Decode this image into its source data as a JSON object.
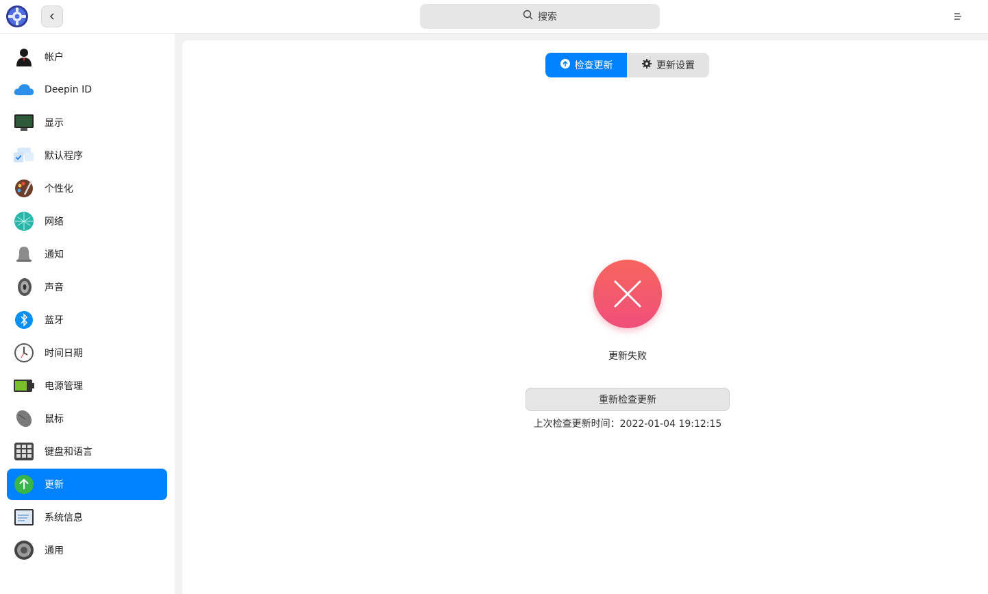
{
  "titlebar": {
    "search_placeholder": "搜索",
    "icons": {
      "logo": "settings-gear-logo-icon",
      "back": "chevron-left-icon",
      "menu": "menu-icon",
      "search": "search-icon"
    }
  },
  "sidebar": {
    "items": [
      {
        "label": "帐户",
        "icon": "account-icon"
      },
      {
        "label": "Deepin ID",
        "icon": "cloud-icon"
      },
      {
        "label": "显示",
        "icon": "monitor-icon"
      },
      {
        "label": "默认程序",
        "icon": "default-apps-icon"
      },
      {
        "label": "个性化",
        "icon": "palette-icon"
      },
      {
        "label": "网络",
        "icon": "network-icon"
      },
      {
        "label": "通知",
        "icon": "bell-icon"
      },
      {
        "label": "声音",
        "icon": "speaker-icon"
      },
      {
        "label": "蓝牙",
        "icon": "bluetooth-icon"
      },
      {
        "label": "时间日期",
        "icon": "clock-icon"
      },
      {
        "label": "电源管理",
        "icon": "battery-icon"
      },
      {
        "label": "鼠标",
        "icon": "mouse-icon"
      },
      {
        "label": "键盘和语言",
        "icon": "keyboard-icon"
      },
      {
        "label": "更新",
        "icon": "update-arrow-icon",
        "active": true
      },
      {
        "label": "系统信息",
        "icon": "system-info-icon"
      },
      {
        "label": "通用",
        "icon": "general-settings-icon"
      }
    ]
  },
  "main": {
    "tabs": [
      {
        "label": "检查更新",
        "icon": "upload-circle-icon",
        "active": true
      },
      {
        "label": "更新设置",
        "icon": "gear-icon",
        "active": false
      }
    ],
    "status": "更新失败",
    "retry_label": "重新检查更新",
    "last_check": "上次检查更新时间：2022-01-04 19:12:15"
  },
  "colors": {
    "accent": "#0081ff",
    "error_gradient_top": "#f7655e",
    "error_gradient_bottom": "#ef4f7a"
  }
}
